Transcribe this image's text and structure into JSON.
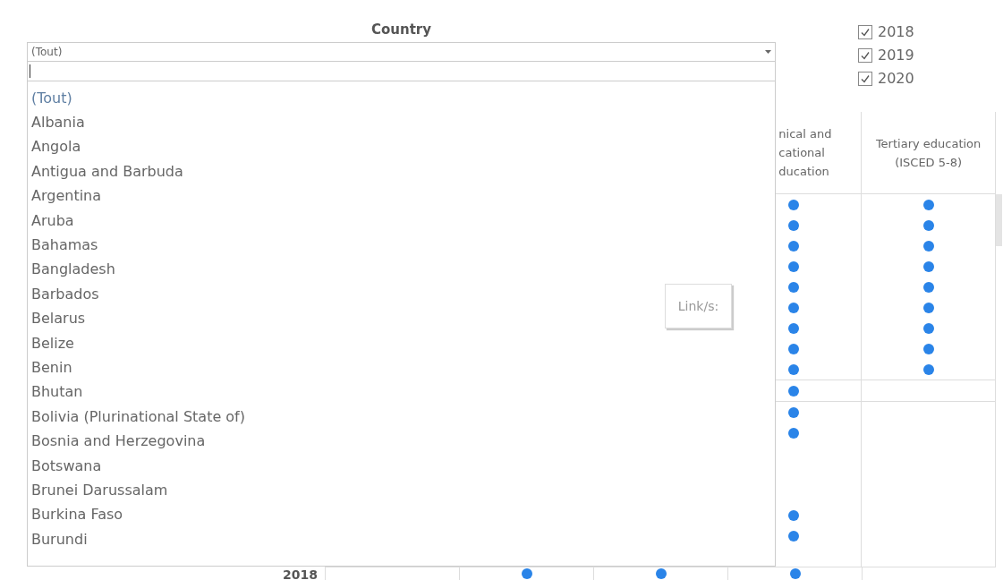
{
  "years": [
    {
      "label": "2018",
      "checked": true
    },
    {
      "label": "2019",
      "checked": true
    },
    {
      "label": "2020",
      "checked": true
    }
  ],
  "table": {
    "headers": [
      {
        "label": "nical and cational ducation"
      },
      {
        "label": "Tertiary education (ISCED 5-8)"
      }
    ],
    "groups": [
      {
        "rows": [
          {
            "technical": true,
            "tertiary": true
          },
          {
            "technical": true,
            "tertiary": true
          },
          {
            "technical": true,
            "tertiary": true
          },
          {
            "technical": true,
            "tertiary": true
          },
          {
            "technical": true,
            "tertiary": true
          },
          {
            "technical": true,
            "tertiary": true
          },
          {
            "technical": true,
            "tertiary": true
          },
          {
            "technical": true,
            "tertiary": true
          },
          {
            "technical": true,
            "tertiary": true
          }
        ]
      },
      {
        "rows": [
          {
            "technical": true,
            "tertiary": false
          }
        ]
      },
      {
        "rows": [
          {
            "technical": true,
            "tertiary": false
          },
          {
            "technical": true,
            "tertiary": false
          },
          {
            "technical": false,
            "tertiary": false
          },
          {
            "technical": false,
            "tertiary": false
          },
          {
            "technical": false,
            "tertiary": false
          },
          {
            "technical": true,
            "tertiary": false
          },
          {
            "technical": true,
            "tertiary": false
          },
          {
            "technical": false,
            "tertiary": false
          }
        ]
      }
    ],
    "year_row": {
      "label": "2018",
      "dots": [
        false,
        true,
        true,
        true,
        false
      ]
    }
  },
  "link_button": {
    "label": "Link/s:"
  },
  "country_filter": {
    "title": "Country",
    "value": "(Tout)",
    "options": [
      {
        "label": "(Tout)",
        "selected": true
      },
      {
        "label": "Albania",
        "selected": false
      },
      {
        "label": "Angola",
        "selected": false
      },
      {
        "label": "Antigua and Barbuda",
        "selected": false
      },
      {
        "label": "Argentina",
        "selected": false
      },
      {
        "label": "Aruba",
        "selected": false
      },
      {
        "label": "Bahamas",
        "selected": false
      },
      {
        "label": "Bangladesh",
        "selected": false
      },
      {
        "label": "Barbados",
        "selected": false
      },
      {
        "label": "Belarus",
        "selected": false
      },
      {
        "label": "Belize",
        "selected": false
      },
      {
        "label": "Benin",
        "selected": false
      },
      {
        "label": "Bhutan",
        "selected": false
      },
      {
        "label": "Bolivia (Plurinational State of)",
        "selected": false
      },
      {
        "label": "Bosnia and Herzegovina",
        "selected": false
      },
      {
        "label": "Botswana",
        "selected": false
      },
      {
        "label": "Brunei Darussalam",
        "selected": false
      },
      {
        "label": "Burkina Faso",
        "selected": false
      },
      {
        "label": "Burundi",
        "selected": false
      }
    ]
  }
}
